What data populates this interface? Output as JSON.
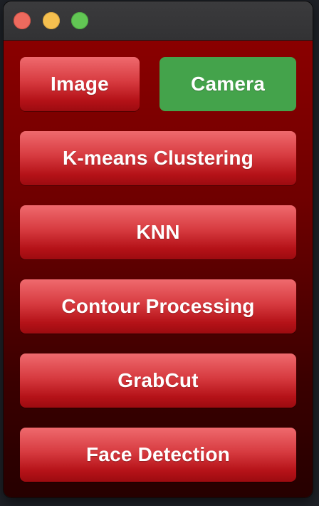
{
  "window": {
    "controls": {
      "close_icon": "close-icon",
      "minimize_icon": "minimize-icon",
      "maximize_icon": "maximize-icon"
    }
  },
  "colors": {
    "button_red": "#d73b40",
    "button_green": "#44a34b",
    "background_top": "#8a0000",
    "background_bottom": "#260000"
  },
  "buttons": {
    "image": "Image",
    "camera": "Camera",
    "kmeans": "K-means Clustering",
    "knn": "KNN",
    "contour": "Contour Processing",
    "grabcut": "GrabCut",
    "face": "Face Detection"
  }
}
